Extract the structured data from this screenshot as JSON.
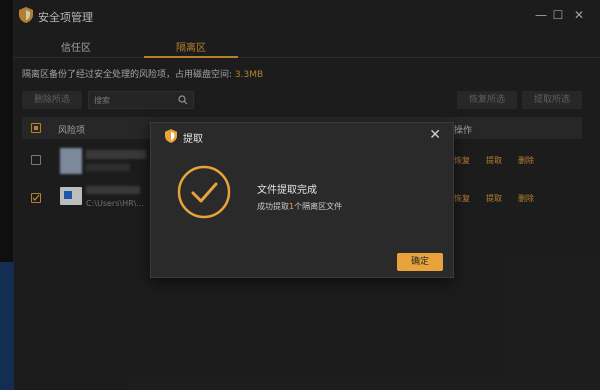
{
  "window": {
    "title": "安全项管理",
    "minimize_glyph": "—",
    "maximize_glyph": "☐",
    "close_glyph": "✕"
  },
  "tabs": [
    {
      "label": "信任区",
      "active": false
    },
    {
      "label": "隔离区",
      "active": true
    }
  ],
  "quarantine": {
    "description": "隔离区备份了经过安全处理的风险项，占用磁盘空间:",
    "disk_usage": "3.3MB"
  },
  "toolbar": {
    "delete_selected": "删除所选",
    "search_placeholder": "搜索",
    "restore_selected": "恢复所选",
    "extract_selected": "提取所选"
  },
  "table": {
    "headers": {
      "risk_item": "风险项",
      "action": "操作"
    },
    "rows": [
      {
        "path": "",
        "checked": false,
        "actions": [
          "恢复",
          "提取",
          "删除"
        ]
      },
      {
        "path": "C:\\Users\\HR\\...",
        "checked": true,
        "actions": [
          "恢复",
          "提取",
          "删除"
        ]
      }
    ]
  },
  "dialog": {
    "title": "提取",
    "message_title": "文件提取完成",
    "message_prefix": "成功提取",
    "count": "1",
    "message_suffix": "个隔离区文件",
    "confirm": "确定",
    "close_glyph": "✕"
  },
  "colors": {
    "accent": "#e8a33c",
    "background": "#252525",
    "dialog_bg": "#2a2a2a"
  },
  "icons": [
    "shield-icon",
    "search-icon",
    "checkmark-circle-icon",
    "close-icon",
    "file-icon"
  ]
}
